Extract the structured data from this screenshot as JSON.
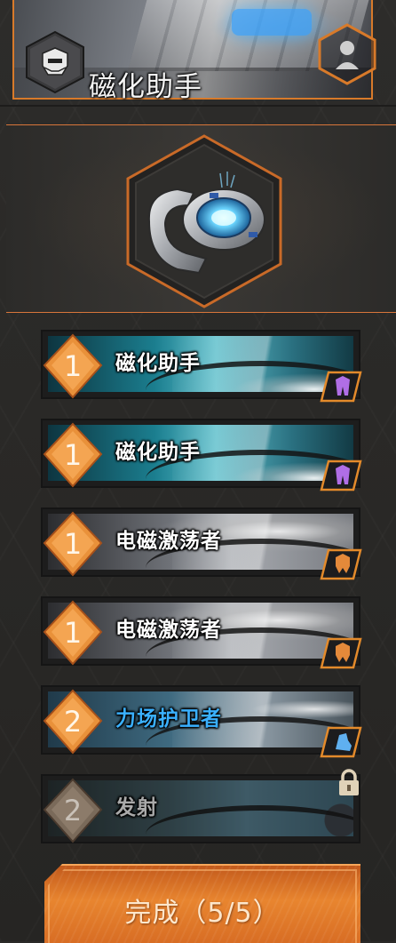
{
  "header": {
    "title": "磁化助手",
    "emblem_icon": "mech-helmet-icon",
    "corner_icon": "hexagon-orb-icon"
  },
  "showcase": {
    "item_icon": "magnetic-gauntlet-icon"
  },
  "skills": [
    {
      "level": "1",
      "name": "磁化助手",
      "type_icon": "purple-mech-icon",
      "style": "teal",
      "name_color": "white",
      "locked": false
    },
    {
      "level": "1",
      "name": "磁化助手",
      "type_icon": "purple-mech-icon",
      "style": "teal",
      "name_color": "white",
      "locked": false
    },
    {
      "level": "1",
      "name": "电磁激荡者",
      "type_icon": "orange-mech-icon",
      "style": "grey",
      "name_color": "white",
      "locked": false
    },
    {
      "level": "1",
      "name": "电磁激荡者",
      "type_icon": "orange-mech-icon",
      "style": "grey",
      "name_color": "white",
      "locked": false
    },
    {
      "level": "2",
      "name": "力场护卫者",
      "type_icon": "blue-armor-icon",
      "style": "blue",
      "name_color": "blue",
      "locked": false
    },
    {
      "level": "2",
      "name": "发射",
      "type_icon": "",
      "style": "locked",
      "name_color": "dim",
      "locked": true
    }
  ],
  "complete_button": {
    "label": "完成（5/5）"
  },
  "colors": {
    "accent_orange": "#e8852f",
    "border_orange": "#d87a2a",
    "skill_blue": "#3ab0ff"
  }
}
